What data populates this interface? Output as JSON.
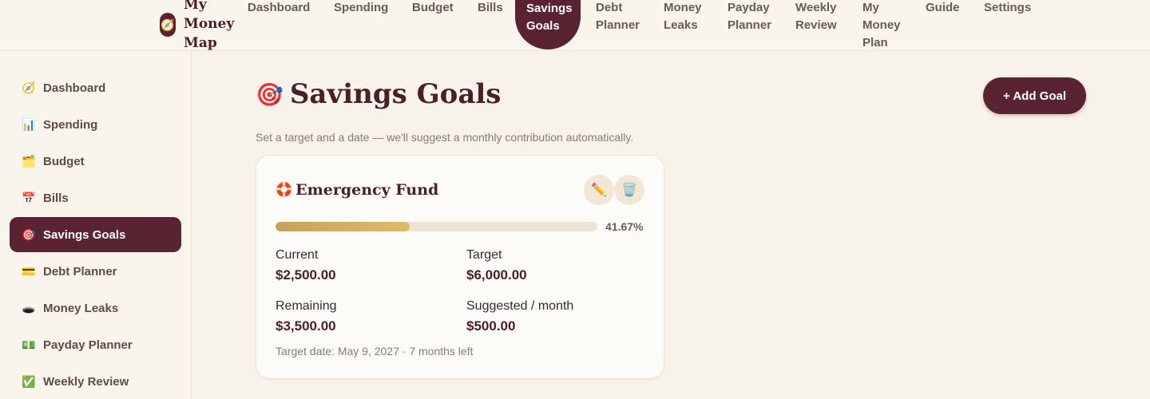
{
  "brand": {
    "name": "My Money Map",
    "logo_icon": "compass-icon"
  },
  "topnav": [
    {
      "label": "Dashboard"
    },
    {
      "label": "Spending"
    },
    {
      "label": "Budget"
    },
    {
      "label": "Bills"
    },
    {
      "label": "Savings Goals",
      "active": true
    },
    {
      "label": "Debt Planner"
    },
    {
      "label": "Money Leaks"
    },
    {
      "label": "Payday Planner"
    },
    {
      "label": "Weekly Review"
    },
    {
      "label": "My Money Plan"
    },
    {
      "label": "Guide"
    },
    {
      "label": "Settings"
    }
  ],
  "sidebar": [
    {
      "icon": "🧭",
      "label": "Dashboard"
    },
    {
      "icon": "📊",
      "label": "Spending"
    },
    {
      "icon": "🗂️",
      "label": "Budget"
    },
    {
      "icon": "📅",
      "label": "Bills"
    },
    {
      "icon": "🎯",
      "label": "Savings Goals",
      "active": true
    },
    {
      "icon": "💳",
      "label": "Debt Planner"
    },
    {
      "icon": "🕳️",
      "label": "Money Leaks"
    },
    {
      "icon": "💵",
      "label": "Payday Planner"
    },
    {
      "icon": "✅",
      "label": "Weekly Review"
    }
  ],
  "page": {
    "icon": "🎯",
    "title": "Savings Goals",
    "subtitle": "Set a target and a date — we'll suggest a monthly contribution automatically.",
    "add_button": "+ Add Goal"
  },
  "goal": {
    "icon": "🛟",
    "name": "Emergency Fund",
    "edit_icon": "✏️",
    "delete_icon": "🗑️",
    "progress": 0.4167,
    "progress_label": "41.67%",
    "current_label": "Current",
    "current_value": "$2,500.00",
    "target_label": "Target",
    "target_value": "$6,000.00",
    "remaining_label": "Remaining",
    "remaining_value": "$3,500.00",
    "suggested_label": "Suggested / month",
    "suggested_value": "$500.00",
    "target_date": "Target date: May 9, 2027 · 7 months left"
  },
  "colors": {
    "accent": "#5a2331",
    "background": "#f7f2ea",
    "progress": "#d4b463"
  }
}
